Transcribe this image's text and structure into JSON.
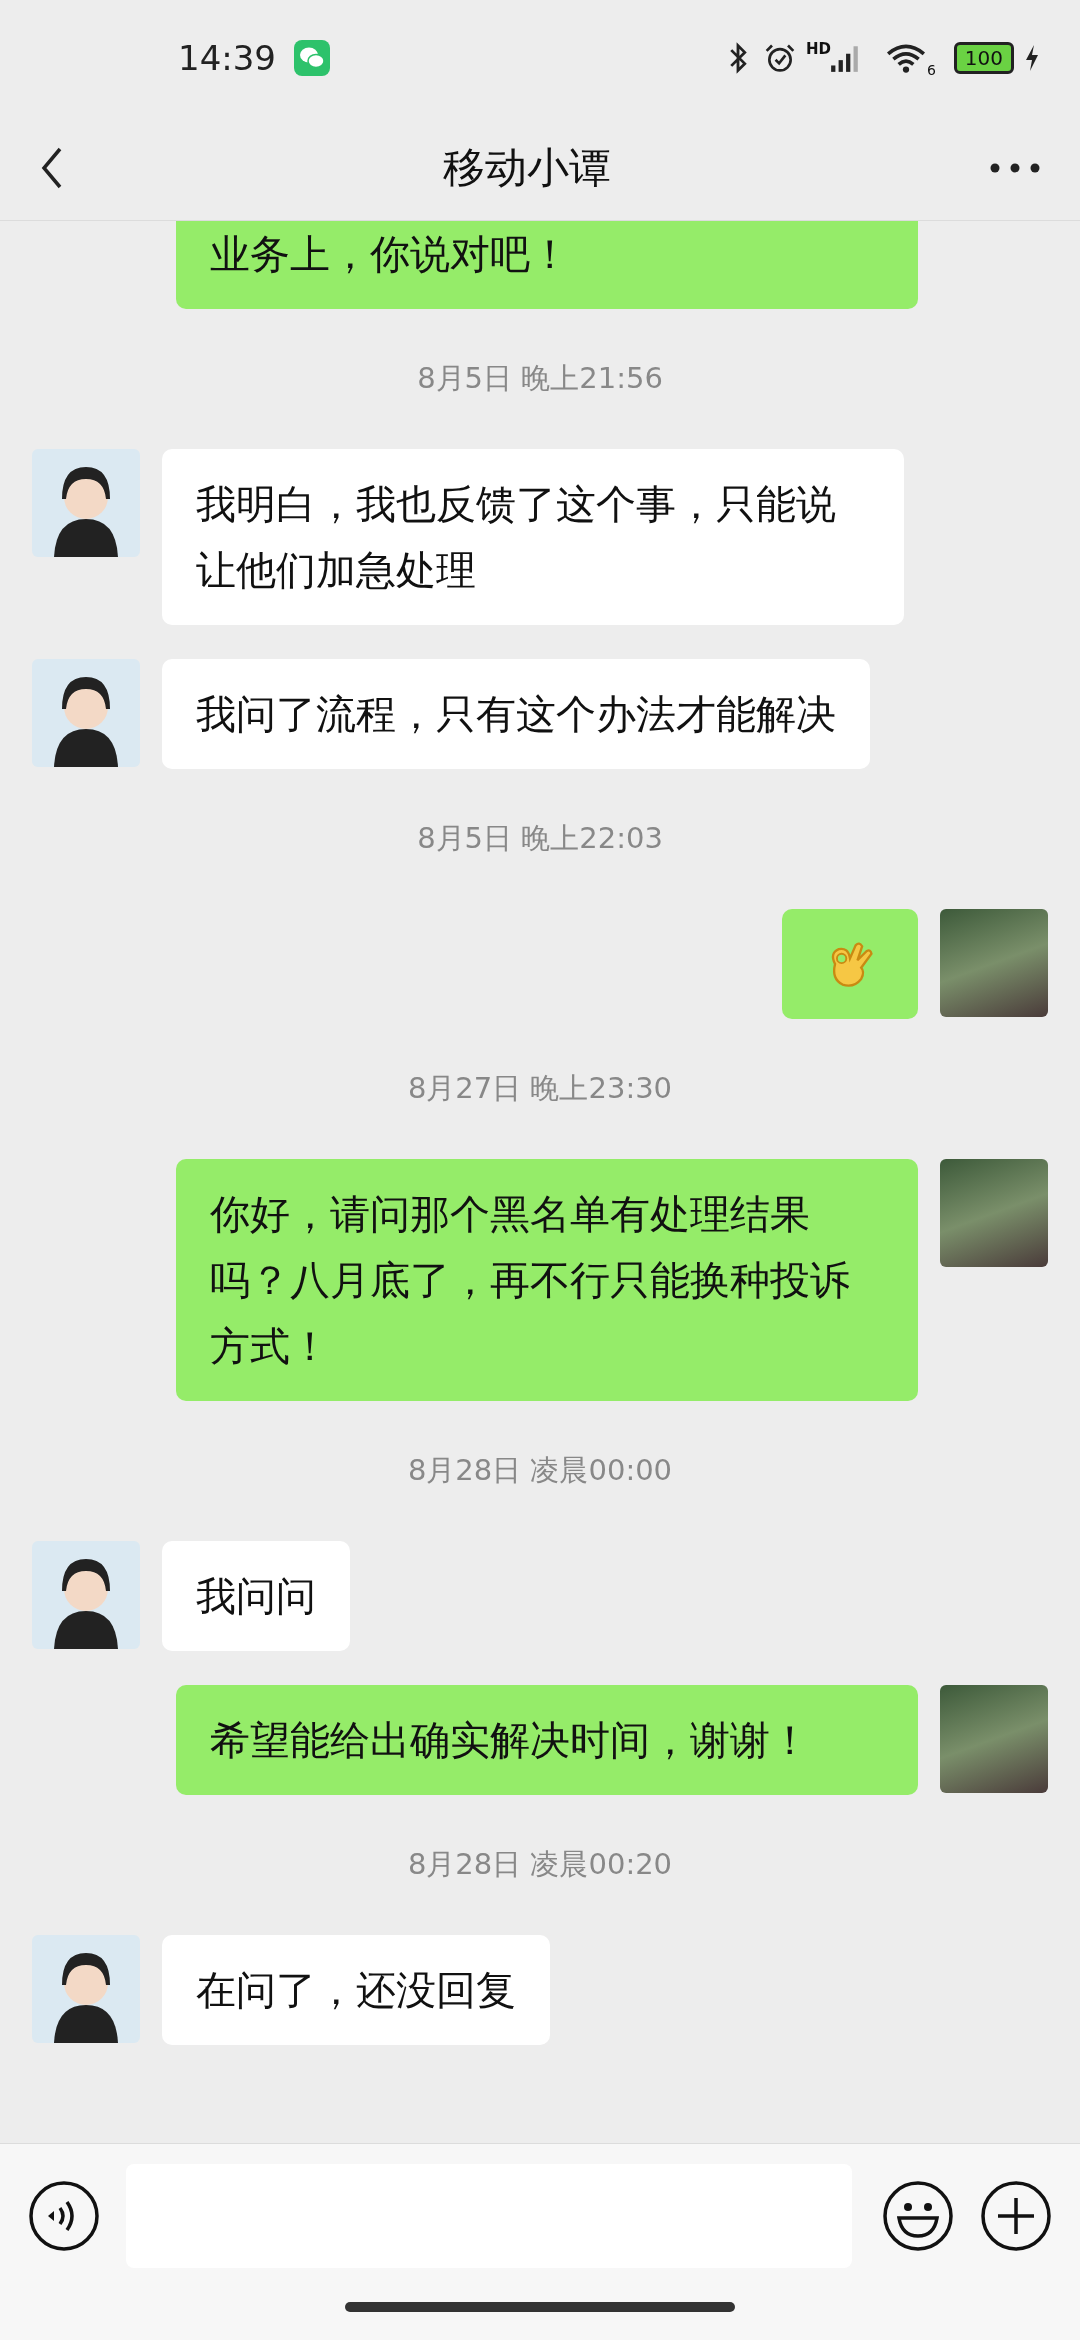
{
  "status_bar": {
    "time": "14:39",
    "battery": "100",
    "wifi_badge": "6",
    "signal_badge": "HD"
  },
  "header": {
    "title": "移动小谭"
  },
  "messages": [
    {
      "kind": "text",
      "outgoing": true,
      "text": "业务上，你说对吧！",
      "cut": true
    },
    {
      "kind": "time",
      "text": "8月5日 晚上21:56"
    },
    {
      "kind": "text",
      "outgoing": false,
      "text": "我明白，我也反馈了这个事，只能说让他们加急处理"
    },
    {
      "kind": "text",
      "outgoing": false,
      "text": "我问了流程，只有这个办法才能解决"
    },
    {
      "kind": "time",
      "text": "8月5日 晚上22:03"
    },
    {
      "kind": "emoji",
      "outgoing": true
    },
    {
      "kind": "time",
      "text": "8月27日 晚上23:30"
    },
    {
      "kind": "text",
      "outgoing": true,
      "text": "你好，请问那个黑名单有处理结果吗？八月底了，再不行只能换种投诉方式！"
    },
    {
      "kind": "time",
      "text": "8月28日 凌晨00:00"
    },
    {
      "kind": "text",
      "outgoing": false,
      "text": "我问问"
    },
    {
      "kind": "text",
      "outgoing": true,
      "text": "希望能给出确实解决时间，谢谢！"
    },
    {
      "kind": "time",
      "text": "8月28日 凌晨00:20"
    },
    {
      "kind": "text",
      "outgoing": false,
      "text": "在问了，还没回复"
    }
  ]
}
